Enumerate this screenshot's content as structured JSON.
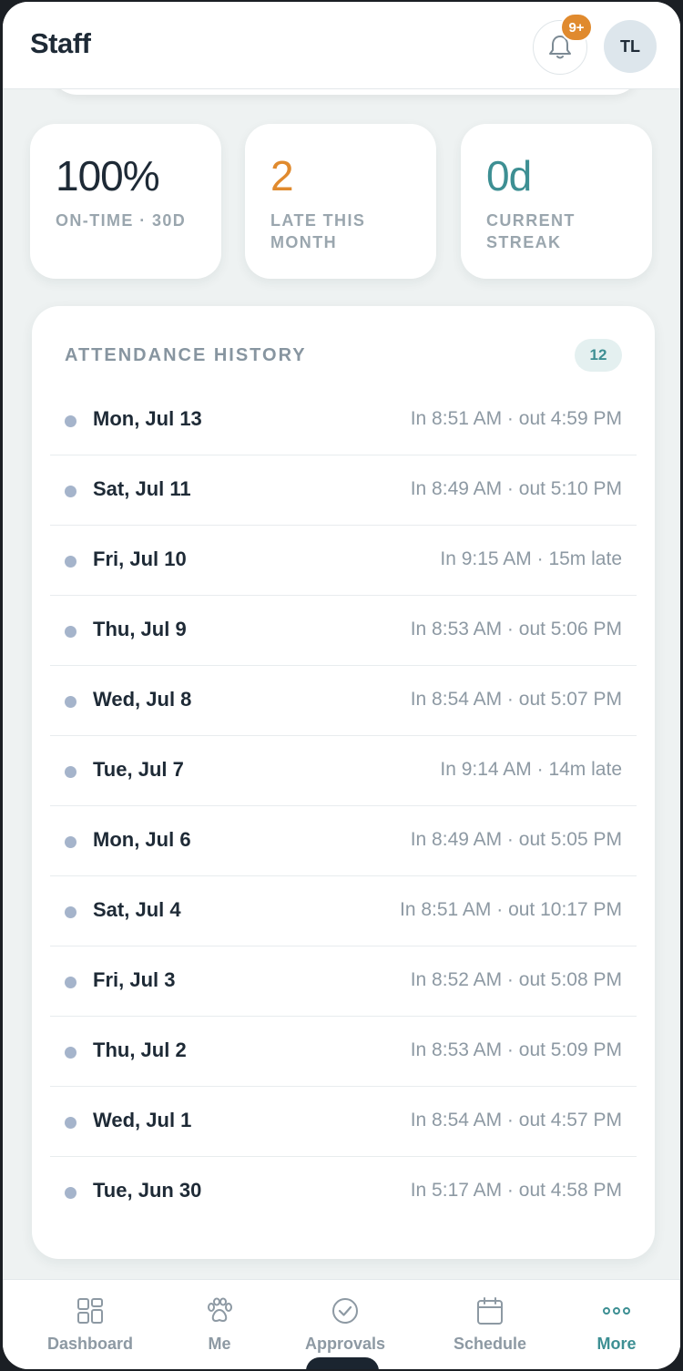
{
  "header": {
    "title": "Staff",
    "notification_badge": "9+",
    "avatar_initials": "TL"
  },
  "stats": [
    {
      "value": "100%",
      "label": "ON-TIME · 30D",
      "color": "#1e2a36"
    },
    {
      "value": "2",
      "label": "LATE THIS MONTH",
      "color": "#e08a2e"
    },
    {
      "value": "0d",
      "label": "CURRENT STREAK",
      "color": "#3d8f93"
    }
  ],
  "history": {
    "title": "ATTENDANCE HISTORY",
    "count": "12",
    "rows": [
      {
        "date": "Mon, Jul 13",
        "time": "In 8:51 AM · out 4:59 PM"
      },
      {
        "date": "Sat, Jul 11",
        "time": "In 8:49 AM · out 5:10 PM"
      },
      {
        "date": "Fri, Jul 10",
        "time": "In 9:15 AM · 15m late"
      },
      {
        "date": "Thu, Jul 9",
        "time": "In 8:53 AM · out 5:06 PM"
      },
      {
        "date": "Wed, Jul 8",
        "time": "In 8:54 AM · out 5:07 PM"
      },
      {
        "date": "Tue, Jul 7",
        "time": "In 9:14 AM · 14m late"
      },
      {
        "date": "Mon, Jul 6",
        "time": "In 8:49 AM · out 5:05 PM"
      },
      {
        "date": "Sat, Jul 4",
        "time": "In 8:51 AM · out 10:17 PM"
      },
      {
        "date": "Fri, Jul 3",
        "time": "In 8:52 AM · out 5:08 PM"
      },
      {
        "date": "Thu, Jul 2",
        "time": "In 8:53 AM · out 5:09 PM"
      },
      {
        "date": "Wed, Jul 1",
        "time": "In 8:54 AM · out 4:57 PM"
      },
      {
        "date": "Tue, Jun 30",
        "time": "In 5:17 AM · out 4:58 PM"
      }
    ]
  },
  "nav": {
    "items": [
      {
        "label": "Dashboard",
        "icon": "dashboard-grid-icon",
        "active": false
      },
      {
        "label": "Me",
        "icon": "paw-icon",
        "active": false
      },
      {
        "label": "Approvals",
        "icon": "check-circle-icon",
        "active": false
      },
      {
        "label": "Schedule",
        "icon": "calendar-icon",
        "active": false
      },
      {
        "label": "More",
        "icon": "more-dots-icon",
        "active": true
      }
    ]
  },
  "colors": {
    "accent": "#3d8f93",
    "warning": "#e08a2e",
    "text_dark": "#1e2a36",
    "text_muted": "#8d99a3"
  }
}
